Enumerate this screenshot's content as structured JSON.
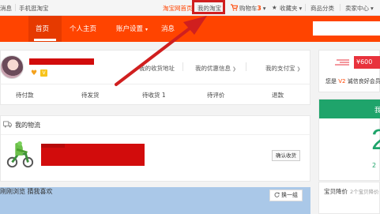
{
  "topbar": {
    "msg": "消息",
    "mobile": "手机逛淘宝",
    "taobao_home": "淘宝网首页",
    "my_taobao": "我的淘宝",
    "cart_label": "购物车",
    "cart_count": "3",
    "favorites": "收藏夹",
    "categories": "商品分类",
    "seller_center": "卖家中心",
    "accent": "#ff4400"
  },
  "nav": {
    "home": "首页",
    "personal": "个人主页",
    "account": "账户设置",
    "news": "消息"
  },
  "profile": {
    "receive_address": "我的收货地址",
    "my_benefits": "我的优惠信息",
    "my_alipay": "我的支付宝",
    "vip_badge": "V"
  },
  "orders": {
    "to_pay": "待付款",
    "to_ship": "待发货",
    "to_receive": "待收货",
    "to_receive_count": "1",
    "to_review": "待评价",
    "refund": "退款"
  },
  "logistics": {
    "title": "我的物流",
    "confirm_button": "确认收货"
  },
  "recommend": {
    "title": "刚刚浏览  猜我喜欢",
    "change_button": "换一组"
  },
  "right": {
    "coupon": "¥600",
    "vip_prefix": "您是",
    "vip_level": "V2",
    "vip_suffix": "诚信良好会员，",
    "green_title": "我",
    "big_number": "2",
    "small_number": "2",
    "price_drop": "宝贝降价",
    "price_drop_note": "2个宝贝降价"
  }
}
